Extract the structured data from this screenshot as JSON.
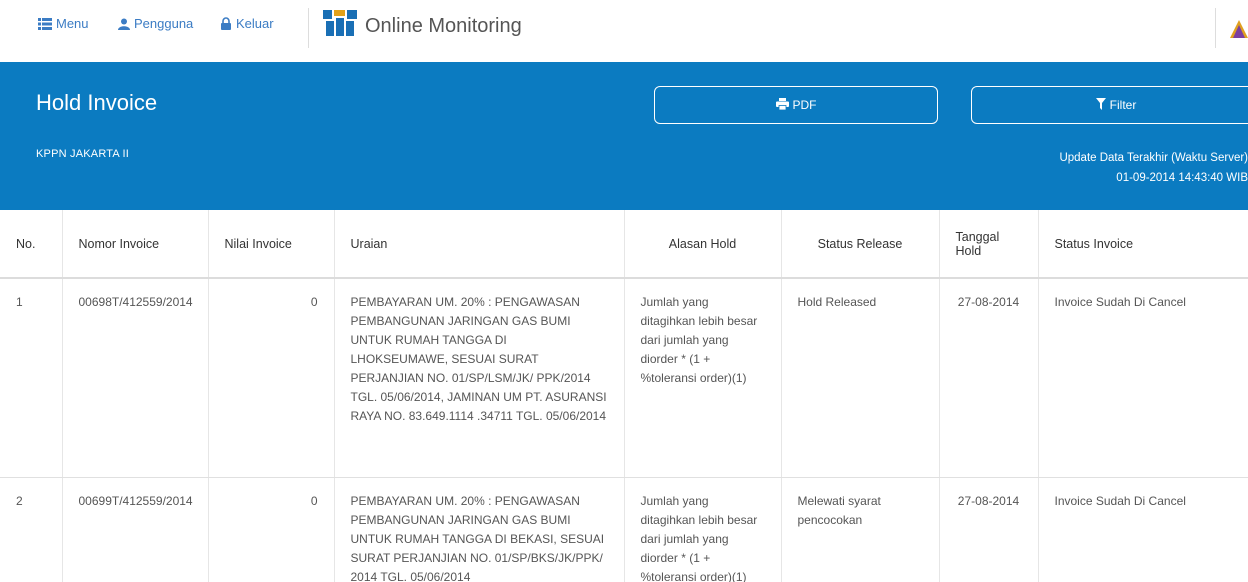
{
  "nav": {
    "menu_label": "Menu",
    "user_label": "Pengguna",
    "logout_label": "Keluar",
    "app_title": "Online Monitoring"
  },
  "header": {
    "title": "Hold Invoice",
    "subtitle": "KPPN JAKARTA II",
    "pdf_label": "PDF",
    "filter_label": "Filter",
    "update_label": "Update Data Terakhir (Waktu Server)",
    "update_time": "01-09-2014 14:43:40 WIB"
  },
  "table": {
    "columns": [
      "No.",
      "Nomor Invoice",
      "Nilai Invoice",
      "Uraian",
      "Alasan Hold",
      "Status Release",
      "Tanggal Hold",
      "Status Invoice"
    ],
    "rows": [
      {
        "no": "1",
        "nomor": "00698T/412559/2014",
        "nilai": "0",
        "uraian": "PEMBAYARAN UM. 20% : PENGAWASAN PEMBANGUNAN JARINGAN GAS BUMI UNTUK RUMAH TANGGA DI LHOKSEUMAWE, SESUAI SURAT PERJANJIAN NO. 01/SP/LSM/JK/ PPK/2014 TGL. 05/06/2014, JAMINAN UM PT. ASURANSI RAYA NO. 83.649.1114 .34711 TGL. 05/06/2014",
        "alasan": "Jumlah yang ditagihkan lebih besar dari jumlah yang diorder * (1 + %toleransi order)(1)",
        "status_release": "Hold Released",
        "tanggal": "27-08-2014",
        "status_invoice": "Invoice Sudah Di Cancel"
      },
      {
        "no": "2",
        "nomor": "00699T/412559/2014",
        "nilai": "0",
        "uraian": "PEMBAYARAN UM. 20% : PENGAWASAN PEMBANGUNAN JARINGAN GAS BUMI UNTUK RUMAH TANGGA DI BEKASI, SESUAI SURAT PERJANJIAN NO. 01/SP/BKS/JK/PPK/ 2014 TGL. 05/06/2014",
        "alasan": "Jumlah yang ditagihkan lebih besar dari jumlah yang diorder * (1 + %toleransi order)(1)",
        "status_release": "Melewati syarat pencocokan",
        "tanggal": "27-08-2014",
        "status_invoice": "Invoice Sudah Di Cancel"
      }
    ]
  },
  "colors": {
    "band": "#0b7bc1",
    "nav_link": "#3b7cc4",
    "band_rule": "#33a3e0"
  },
  "icons": {
    "menu": "list-icon",
    "user": "user-icon",
    "logout": "lock-icon",
    "brand": "brand-logo-icon",
    "pdf": "print-icon",
    "filter": "filter-icon"
  }
}
